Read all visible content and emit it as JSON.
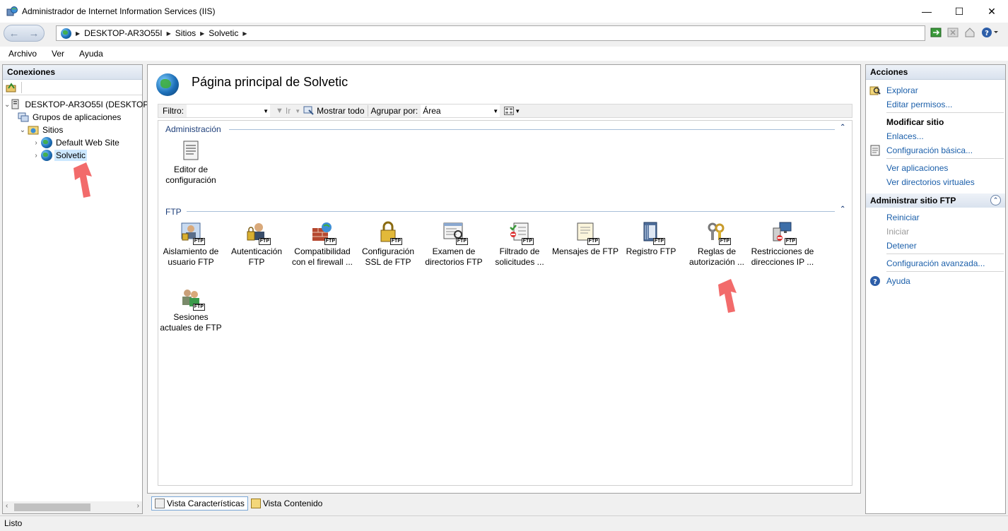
{
  "window": {
    "title": "Administrador de Internet Information Services (IIS)",
    "minimize": "—",
    "maximize": "☐",
    "close": "✕"
  },
  "address": {
    "back": "←",
    "forward": "→",
    "crumbs": [
      "DESKTOP-AR3O55I",
      "Sitios",
      "Solvetic"
    ]
  },
  "menu": [
    "Archivo",
    "Ver",
    "Ayuda"
  ],
  "connections": {
    "header": "Conexiones",
    "tree": [
      {
        "label": "DESKTOP-AR3O55I (DESKTOP",
        "icon": "server-icon",
        "expanded": true
      },
      {
        "label": "Grupos de aplicaciones",
        "icon": "app-pools-icon"
      },
      {
        "label": "Sitios",
        "icon": "sites-folder-icon",
        "expanded": true
      },
      {
        "label": "Default Web Site",
        "icon": "globe-icon",
        "expanded": false
      },
      {
        "label": "Solvetic",
        "icon": "globe-icon",
        "expanded": false,
        "selected": true
      }
    ]
  },
  "main": {
    "title": "Página principal de Solvetic",
    "filter": {
      "label": "Filtro:",
      "go_label": "Ir",
      "show_all_label": "Mostrar todo",
      "group_by_label": "Agrupar por:",
      "group_by_value": "Área"
    },
    "groups": [
      {
        "name": "Administración",
        "features": [
          {
            "label": "Editor de configuración",
            "icon": "config-editor-icon"
          }
        ]
      },
      {
        "name": "FTP",
        "features": [
          {
            "label": "Aislamiento de usuario FTP",
            "icon": "ftp-user-isolation-icon"
          },
          {
            "label": "Autenticación FTP",
            "icon": "ftp-authentication-icon"
          },
          {
            "label": "Compatibilidad con el firewall ...",
            "icon": "ftp-firewall-icon"
          },
          {
            "label": "Configuración SSL de FTP",
            "icon": "ftp-ssl-icon"
          },
          {
            "label": "Examen de directorios FTP",
            "icon": "ftp-directory-browsing-icon"
          },
          {
            "label": "Filtrado de solicitudes ...",
            "icon": "ftp-request-filtering-icon"
          },
          {
            "label": "Mensajes de FTP",
            "icon": "ftp-messages-icon"
          },
          {
            "label": "Registro FTP",
            "icon": "ftp-logging-icon"
          },
          {
            "label": "Reglas de autorización ...",
            "icon": "ftp-authorization-rules-icon"
          },
          {
            "label": "Restricciones de direcciones IP ...",
            "icon": "ftp-ip-restrictions-icon"
          },
          {
            "label": "Sesiones actuales de FTP",
            "icon": "ftp-sessions-icon"
          }
        ]
      }
    ],
    "ftp_badge": "FTP",
    "tabs": [
      {
        "label": "Vista Características",
        "active": true
      },
      {
        "label": "Vista Contenido",
        "active": false
      }
    ]
  },
  "actions": {
    "header": "Acciones",
    "explore": "Explorar",
    "edit_permissions": "Editar permisos...",
    "modify_site": "Modificar sitio",
    "bindings": "Enlaces...",
    "basic_settings": "Configuración básica...",
    "view_applications": "Ver aplicaciones",
    "view_virtual_dirs": "Ver directorios virtuales",
    "ftp_section": "Administrar sitio FTP",
    "restart": "Reiniciar",
    "start": "Iniciar",
    "stop": "Detener",
    "advanced_settings": "Configuración avanzada...",
    "help": "Ayuda"
  },
  "status": {
    "text": "Listo"
  },
  "colors": {
    "link": "#1b5faa",
    "group_header": "#1e3f7a",
    "selection": "#cce8ff",
    "annotation_arrow": "#f26b6b"
  }
}
